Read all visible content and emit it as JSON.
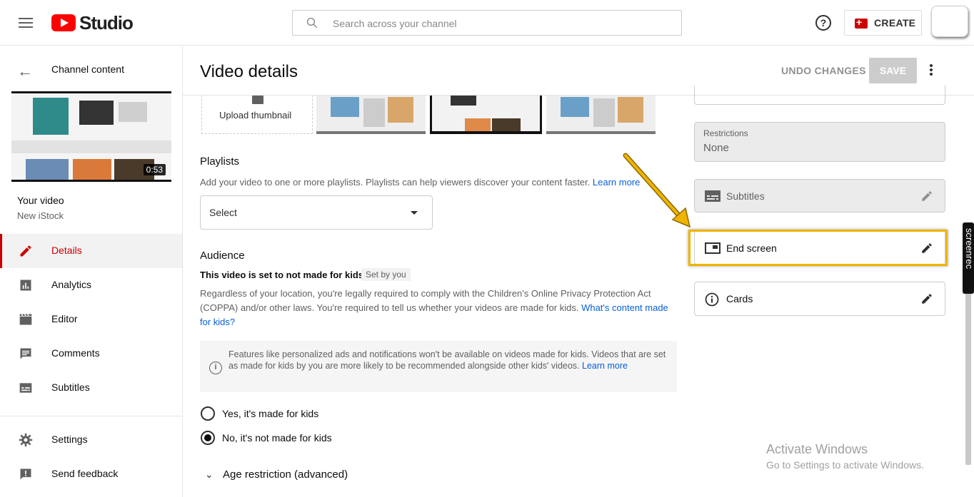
{
  "header": {
    "logo_text": "Studio",
    "search_placeholder": "Search across your channel",
    "help_symbol": "?",
    "create_label": "CREATE"
  },
  "sidebar": {
    "back_label": "Channel content",
    "thumbnail_duration": "0:53",
    "your_video_label": "Your video",
    "video_title": "New iStock",
    "nav_items": [
      {
        "label": "Details",
        "icon": "pencil-icon",
        "active": true
      },
      {
        "label": "Analytics",
        "icon": "analytics-icon",
        "active": false
      },
      {
        "label": "Editor",
        "icon": "editor-icon",
        "active": false
      },
      {
        "label": "Comments",
        "icon": "comments-icon",
        "active": false
      },
      {
        "label": "Subtitles",
        "icon": "subtitles-icon",
        "active": false
      }
    ],
    "bottom_items": [
      {
        "label": "Settings",
        "icon": "gear-icon"
      },
      {
        "label": "Send feedback",
        "icon": "feedback-icon"
      }
    ]
  },
  "main": {
    "title": "Video details",
    "undo_label": "UNDO CHANGES",
    "save_label": "SAVE",
    "upload_thumbnail_label": "Upload thumbnail",
    "playlists": {
      "title": "Playlists",
      "description": "Add your video to one or more playlists. Playlists can help viewers discover your content faster.",
      "learn_more": "Learn more",
      "select_label": "Select"
    },
    "audience": {
      "title": "Audience",
      "status": "This video is set to not made for kids",
      "set_by": "Set by you",
      "description": "Regardless of your location, you're legally required to comply with the Children's Online Privacy Protection Act (COPPA) and/or other laws. You're required to tell us whether your videos are made for kids.",
      "whats_link": "What's content made for kids?",
      "info_text": "Features like personalized ads and notifications won't be available on videos made for kids. Videos that are set as made for kids by you are more likely to be recommended alongside other kids' videos.",
      "info_link": "Learn more",
      "option_yes": "Yes, it's made for kids",
      "option_no": "No, it's not made for kids",
      "selected": "no"
    },
    "age_restriction_label": "Age restriction (advanced)"
  },
  "right_panel": {
    "restrictions_label": "Restrictions",
    "restrictions_value": "None",
    "subtitles_label": "Subtitles",
    "end_screen_label": "End screen",
    "cards_label": "Cards"
  },
  "watermark": {
    "line1": "Activate Windows",
    "line2": "Go to Settings to activate Windows."
  },
  "screenrec_label": "screenrec",
  "colors": {
    "brand_red": "#ff0000",
    "accent_red": "#cc0000",
    "link_blue": "#065fd4",
    "highlight_yellow": "#f0b400"
  }
}
